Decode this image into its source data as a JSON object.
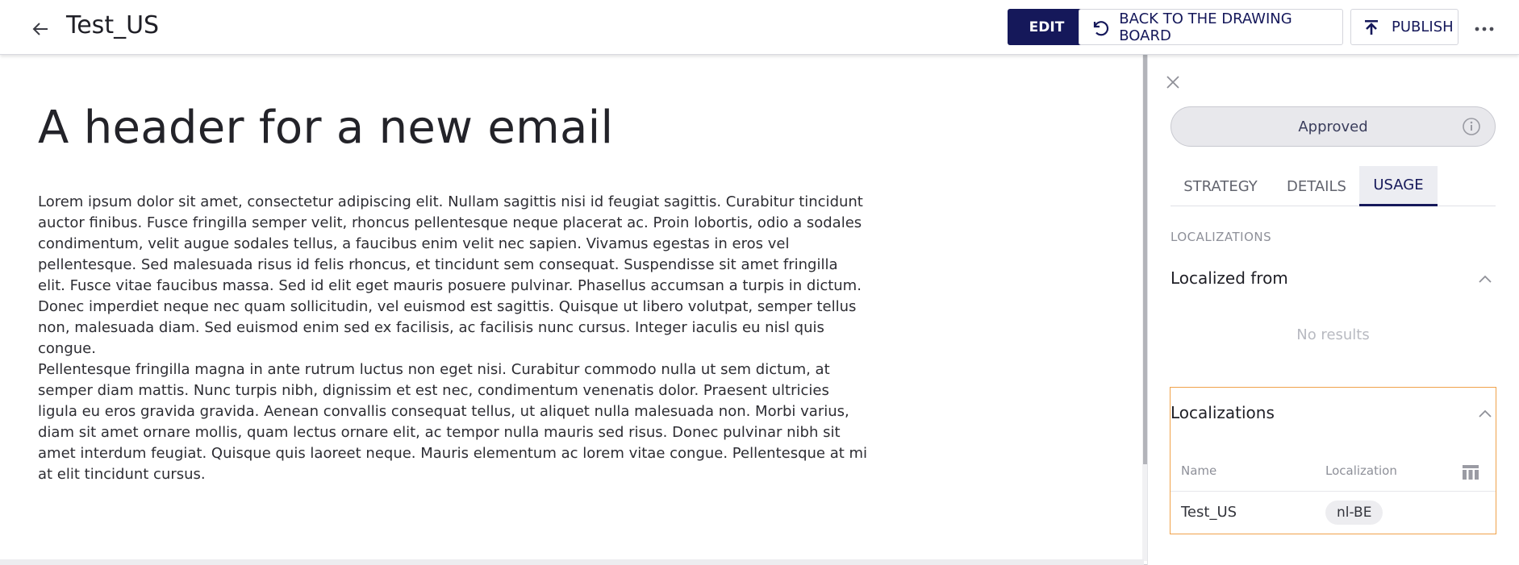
{
  "header": {
    "title": "Test_US",
    "edit_label": "EDIT",
    "back_to_board_label": "BACK TO THE DRAWING BOARD",
    "publish_label": "PUBLISH"
  },
  "content": {
    "email_header": "A header for a new email",
    "paragraphs": [
      "Lorem ipsum dolor sit amet, consectetur adipiscing elit. Nullam sagittis nisi id feugiat sagittis. Curabitur tincidunt auctor finibus. Fusce fringilla semper velit, rhoncus pellentesque neque placerat ac. Proin lobortis, odio a sodales condimentum, velit augue sodales tellus, a faucibus enim velit nec sapien. Vivamus egestas in eros vel pellentesque. Sed malesuada risus id felis rhoncus, et tincidunt sem consequat. Suspendisse sit amet fringilla elit. Fusce vitae faucibus massa. Sed id elit eget mauris posuere pulvinar. Phasellus accumsan a turpis in dictum. Donec imperdiet neque nec quam sollicitudin, vel euismod est sagittis. Quisque ut libero volutpat, semper tellus non, malesuada diam. Sed euismod enim sed ex facilisis, ac facilisis nunc cursus. Integer iaculis eu nisl quis congue.",
      "Pellentesque fringilla magna in ante rutrum luctus non eget nisi. Curabitur commodo nulla ut sem dictum, at semper diam mattis. Nunc turpis nibh, dignissim et est nec, condimentum venenatis dolor. Praesent ultricies ligula eu eros gravida gravida. Aenean convallis consequat tellus, ut aliquet nulla malesuada non. Morbi varius, diam sit amet ornare mollis, quam lectus ornare elit, ac tempor nulla mauris sed risus. Donec pulvinar nibh sit amet interdum feugiat. Quisque quis laoreet neque. Mauris elementum ac lorem vitae congue. Pellentesque at mi at elit tincidunt cursus."
    ]
  },
  "panel": {
    "status": "Approved",
    "tabs": [
      {
        "label": "STRATEGY",
        "active": false
      },
      {
        "label": "DETAILS",
        "active": false
      },
      {
        "label": "USAGE",
        "active": true
      }
    ],
    "section_label": "LOCALIZATIONS",
    "localized_from": {
      "title": "Localized from",
      "empty_text": "No results"
    },
    "localizations": {
      "title": "Localizations",
      "columns": [
        "Name",
        "Localization"
      ],
      "rows": [
        {
          "name": "Test_US",
          "localization": "nl-BE"
        }
      ]
    }
  },
  "icons": {
    "back": "arrow-left-icon",
    "undo": "undo-icon",
    "publish": "upload-icon",
    "more": "more-horizontal-icon",
    "close": "close-icon",
    "info": "info-icon",
    "chevron": "chevron-up-icon",
    "columns": "table-columns-icon"
  },
  "colors": {
    "primary": "#15185a",
    "highlight_border": "#f0a24a",
    "pill_bg": "#e8e8ec"
  }
}
